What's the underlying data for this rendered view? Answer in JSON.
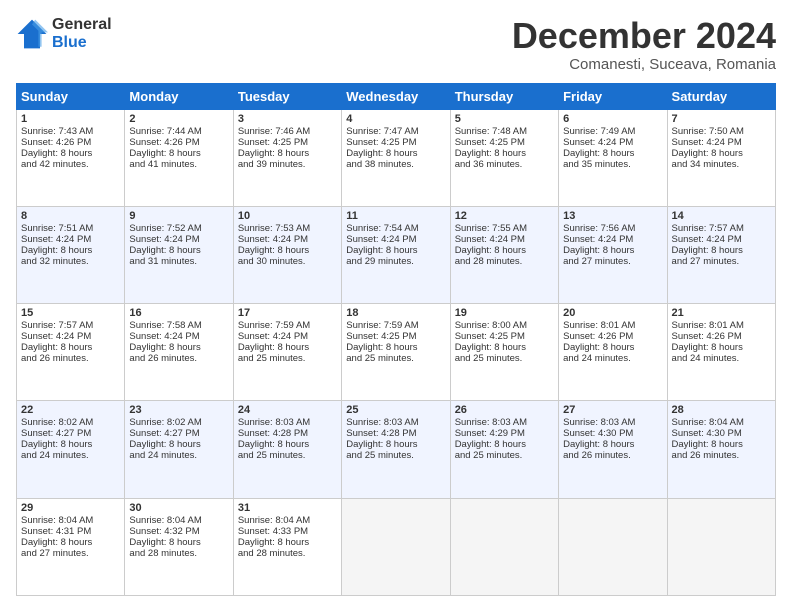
{
  "logo": {
    "general": "General",
    "blue": "Blue"
  },
  "header": {
    "month": "December 2024",
    "location": "Comanesti, Suceava, Romania"
  },
  "weekdays": [
    "Sunday",
    "Monday",
    "Tuesday",
    "Wednesday",
    "Thursday",
    "Friday",
    "Saturday"
  ],
  "weeks": [
    [
      {
        "day": "1",
        "lines": [
          "Sunrise: 7:43 AM",
          "Sunset: 4:26 PM",
          "Daylight: 8 hours",
          "and 42 minutes."
        ]
      },
      {
        "day": "2",
        "lines": [
          "Sunrise: 7:44 AM",
          "Sunset: 4:26 PM",
          "Daylight: 8 hours",
          "and 41 minutes."
        ]
      },
      {
        "day": "3",
        "lines": [
          "Sunrise: 7:46 AM",
          "Sunset: 4:25 PM",
          "Daylight: 8 hours",
          "and 39 minutes."
        ]
      },
      {
        "day": "4",
        "lines": [
          "Sunrise: 7:47 AM",
          "Sunset: 4:25 PM",
          "Daylight: 8 hours",
          "and 38 minutes."
        ]
      },
      {
        "day": "5",
        "lines": [
          "Sunrise: 7:48 AM",
          "Sunset: 4:25 PM",
          "Daylight: 8 hours",
          "and 36 minutes."
        ]
      },
      {
        "day": "6",
        "lines": [
          "Sunrise: 7:49 AM",
          "Sunset: 4:24 PM",
          "Daylight: 8 hours",
          "and 35 minutes."
        ]
      },
      {
        "day": "7",
        "lines": [
          "Sunrise: 7:50 AM",
          "Sunset: 4:24 PM",
          "Daylight: 8 hours",
          "and 34 minutes."
        ]
      }
    ],
    [
      {
        "day": "8",
        "lines": [
          "Sunrise: 7:51 AM",
          "Sunset: 4:24 PM",
          "Daylight: 8 hours",
          "and 32 minutes."
        ]
      },
      {
        "day": "9",
        "lines": [
          "Sunrise: 7:52 AM",
          "Sunset: 4:24 PM",
          "Daylight: 8 hours",
          "and 31 minutes."
        ]
      },
      {
        "day": "10",
        "lines": [
          "Sunrise: 7:53 AM",
          "Sunset: 4:24 PM",
          "Daylight: 8 hours",
          "and 30 minutes."
        ]
      },
      {
        "day": "11",
        "lines": [
          "Sunrise: 7:54 AM",
          "Sunset: 4:24 PM",
          "Daylight: 8 hours",
          "and 29 minutes."
        ]
      },
      {
        "day": "12",
        "lines": [
          "Sunrise: 7:55 AM",
          "Sunset: 4:24 PM",
          "Daylight: 8 hours",
          "and 28 minutes."
        ]
      },
      {
        "day": "13",
        "lines": [
          "Sunrise: 7:56 AM",
          "Sunset: 4:24 PM",
          "Daylight: 8 hours",
          "and 27 minutes."
        ]
      },
      {
        "day": "14",
        "lines": [
          "Sunrise: 7:57 AM",
          "Sunset: 4:24 PM",
          "Daylight: 8 hours",
          "and 27 minutes."
        ]
      }
    ],
    [
      {
        "day": "15",
        "lines": [
          "Sunrise: 7:57 AM",
          "Sunset: 4:24 PM",
          "Daylight: 8 hours",
          "and 26 minutes."
        ]
      },
      {
        "day": "16",
        "lines": [
          "Sunrise: 7:58 AM",
          "Sunset: 4:24 PM",
          "Daylight: 8 hours",
          "and 26 minutes."
        ]
      },
      {
        "day": "17",
        "lines": [
          "Sunrise: 7:59 AM",
          "Sunset: 4:24 PM",
          "Daylight: 8 hours",
          "and 25 minutes."
        ]
      },
      {
        "day": "18",
        "lines": [
          "Sunrise: 7:59 AM",
          "Sunset: 4:25 PM",
          "Daylight: 8 hours",
          "and 25 minutes."
        ]
      },
      {
        "day": "19",
        "lines": [
          "Sunrise: 8:00 AM",
          "Sunset: 4:25 PM",
          "Daylight: 8 hours",
          "and 25 minutes."
        ]
      },
      {
        "day": "20",
        "lines": [
          "Sunrise: 8:01 AM",
          "Sunset: 4:26 PM",
          "Daylight: 8 hours",
          "and 24 minutes."
        ]
      },
      {
        "day": "21",
        "lines": [
          "Sunrise: 8:01 AM",
          "Sunset: 4:26 PM",
          "Daylight: 8 hours",
          "and 24 minutes."
        ]
      }
    ],
    [
      {
        "day": "22",
        "lines": [
          "Sunrise: 8:02 AM",
          "Sunset: 4:27 PM",
          "Daylight: 8 hours",
          "and 24 minutes."
        ]
      },
      {
        "day": "23",
        "lines": [
          "Sunrise: 8:02 AM",
          "Sunset: 4:27 PM",
          "Daylight: 8 hours",
          "and 24 minutes."
        ]
      },
      {
        "day": "24",
        "lines": [
          "Sunrise: 8:03 AM",
          "Sunset: 4:28 PM",
          "Daylight: 8 hours",
          "and 25 minutes."
        ]
      },
      {
        "day": "25",
        "lines": [
          "Sunrise: 8:03 AM",
          "Sunset: 4:28 PM",
          "Daylight: 8 hours",
          "and 25 minutes."
        ]
      },
      {
        "day": "26",
        "lines": [
          "Sunrise: 8:03 AM",
          "Sunset: 4:29 PM",
          "Daylight: 8 hours",
          "and 25 minutes."
        ]
      },
      {
        "day": "27",
        "lines": [
          "Sunrise: 8:03 AM",
          "Sunset: 4:30 PM",
          "Daylight: 8 hours",
          "and 26 minutes."
        ]
      },
      {
        "day": "28",
        "lines": [
          "Sunrise: 8:04 AM",
          "Sunset: 4:30 PM",
          "Daylight: 8 hours",
          "and 26 minutes."
        ]
      }
    ],
    [
      {
        "day": "29",
        "lines": [
          "Sunrise: 8:04 AM",
          "Sunset: 4:31 PM",
          "Daylight: 8 hours",
          "and 27 minutes."
        ]
      },
      {
        "day": "30",
        "lines": [
          "Sunrise: 8:04 AM",
          "Sunset: 4:32 PM",
          "Daylight: 8 hours",
          "and 28 minutes."
        ]
      },
      {
        "day": "31",
        "lines": [
          "Sunrise: 8:04 AM",
          "Sunset: 4:33 PM",
          "Daylight: 8 hours",
          "and 28 minutes."
        ]
      },
      null,
      null,
      null,
      null
    ]
  ]
}
